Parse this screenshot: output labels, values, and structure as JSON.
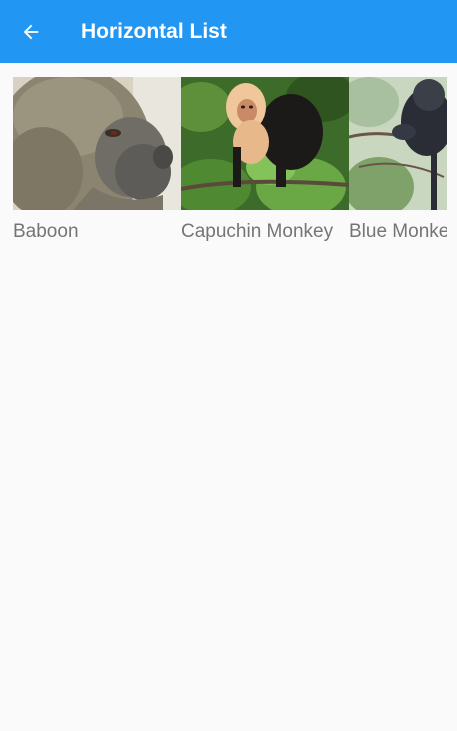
{
  "app_bar": {
    "title": "Horizontal List",
    "back_icon": "arrow-left-icon",
    "background_color": "#2196f3",
    "title_color": "#ffffff"
  },
  "list": {
    "items": [
      {
        "name": "Baboon",
        "image_icon": "baboon-photo"
      },
      {
        "name": "Capuchin Monkey",
        "image_icon": "capuchin-monkey-photo"
      },
      {
        "name": "Blue Monkey",
        "image_icon": "blue-monkey-photo"
      }
    ],
    "label_color": "#757575"
  },
  "page": {
    "background_color": "#fafafa"
  }
}
